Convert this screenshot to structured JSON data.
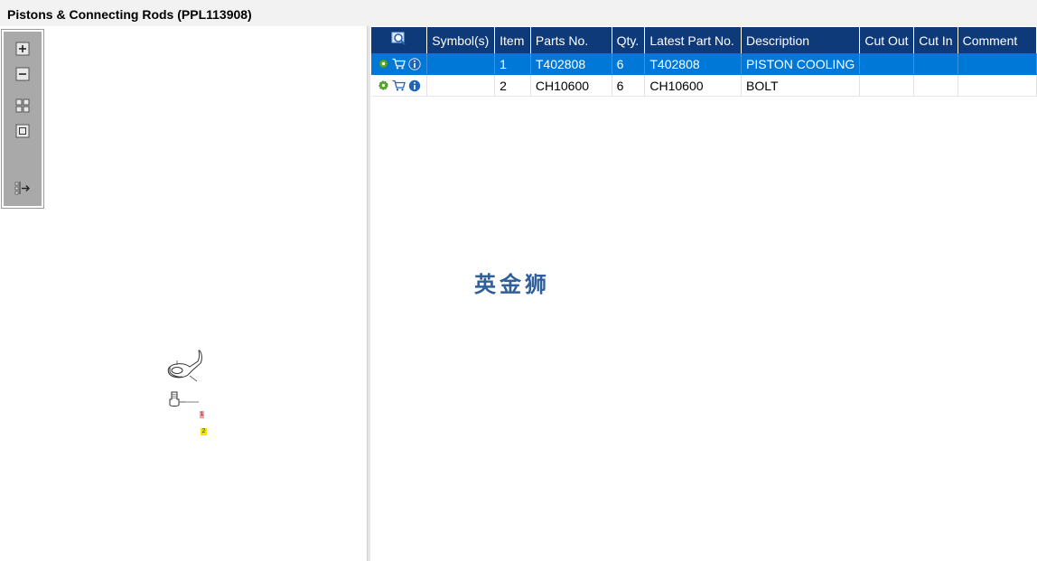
{
  "window": {
    "title": "Pistons & Connecting Rods (PPL113908)"
  },
  "toolbar": {
    "buttons": [
      {
        "name": "zoom-in",
        "icon": "zoom-in-icon"
      },
      {
        "name": "zoom-out",
        "icon": "zoom-out-icon"
      },
      {
        "name": "fit-page",
        "icon": "fit-page-icon"
      },
      {
        "name": "actual-size",
        "icon": "actual-size-icon"
      },
      {
        "name": "export",
        "icon": "export-icon"
      }
    ]
  },
  "diagram": {
    "callouts": [
      {
        "label": "1",
        "color": "#f4a0a0"
      },
      {
        "label": "2",
        "color": "#f2e600"
      }
    ]
  },
  "table": {
    "columns": [
      "",
      "Symbol(s)",
      "Item",
      "Parts No.",
      "Qty.",
      "Latest Part No.",
      "Description",
      "Cut Out",
      "Cut In",
      "Comment"
    ],
    "rows": [
      {
        "symbols": "",
        "item": "1",
        "part_no": "T402808",
        "qty": "6",
        "latest_part_no": "T402808",
        "description": "PISTON COOLING",
        "cut_out": "",
        "cut_in": "",
        "comment": "",
        "selected": true
      },
      {
        "symbols": "",
        "item": "2",
        "part_no": "CH10600",
        "qty": "6",
        "latest_part_no": "CH10600",
        "description": "BOLT",
        "cut_out": "",
        "cut_in": "",
        "comment": "",
        "selected": false
      }
    ]
  },
  "watermark": {
    "text": "英金狮"
  },
  "colors": {
    "header_bg": "#0f3a7a",
    "selected_row": "#0078d7",
    "gear": "#5aa832",
    "cart": "#1f64b5",
    "info": "#1f64b5"
  }
}
